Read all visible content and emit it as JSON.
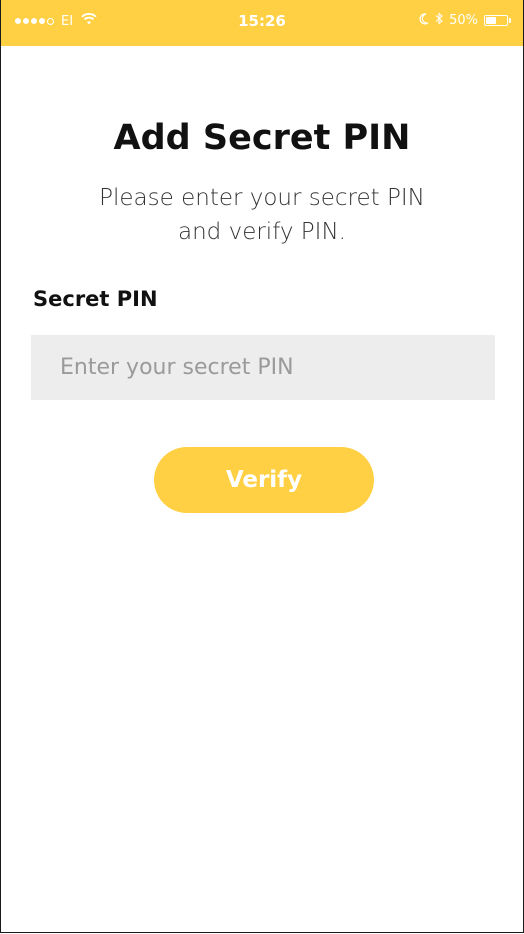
{
  "status_bar": {
    "carrier": "EI",
    "time": "15:26",
    "battery_percent_label": "50%",
    "battery_level": 0.5,
    "icons": [
      "signal-dots",
      "wifi-icon",
      "moon-icon",
      "bluetooth-icon",
      "battery-icon"
    ]
  },
  "colors": {
    "accent": "#FFD044",
    "input_background": "#EDEDED",
    "text_primary": "#111111"
  },
  "header": {
    "title": "Add Secret PIN",
    "subtitle_line1": "Please enter your secret PIN",
    "subtitle_line2": "and verify PIN."
  },
  "form": {
    "pin_label": "Secret PIN",
    "pin_value": "",
    "pin_placeholder": "Enter your secret PIN",
    "verify_label": "Verify"
  }
}
